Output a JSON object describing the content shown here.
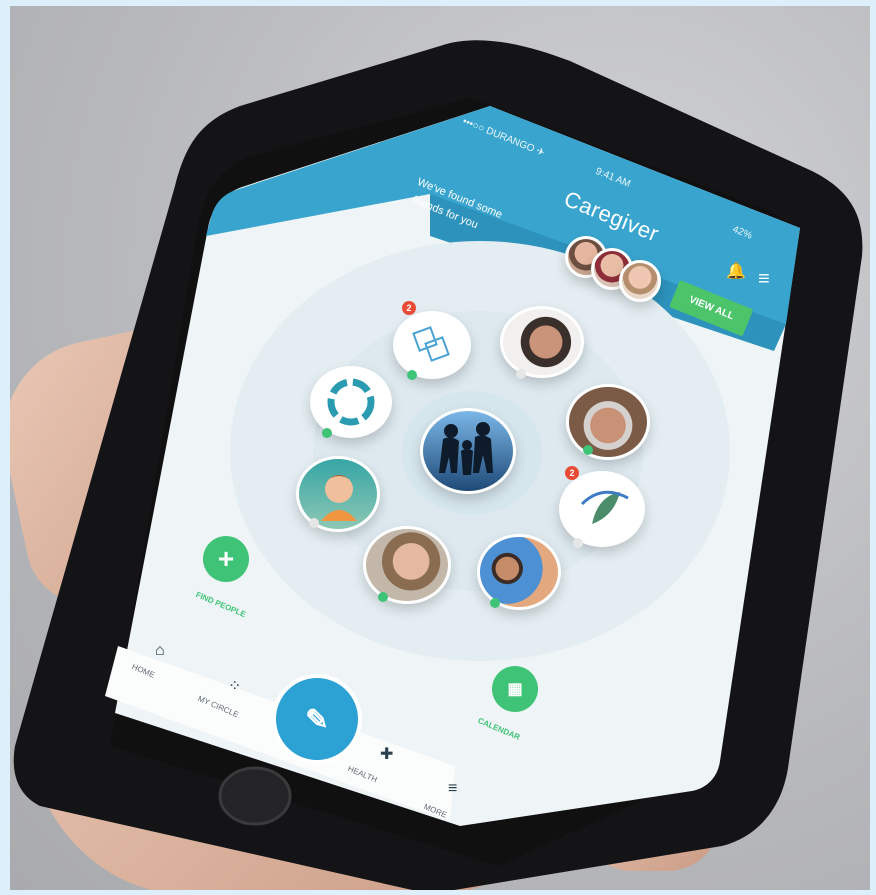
{
  "status_bar": {
    "carrier": "•••○○ DURANGO ✈",
    "time": "9:41 AM",
    "battery": "42%"
  },
  "header": {
    "title": "Caregiver",
    "found_text_1": "We've found some",
    "found_text_2": "friends for you",
    "view_all_label": "VIEW ALL"
  },
  "actions": {
    "find_people_label": "FIND PEOPLE",
    "calendar_label": "CALENDAR"
  },
  "badges": {
    "hub_badge": "2",
    "feather_badge": "2"
  },
  "nav": {
    "home_label": "HOME",
    "my_circle_label": "MY CIRCLE",
    "health_label": "HEALTH",
    "more_label": "MORE"
  },
  "colors": {
    "accent_blue": "#3aa6cf",
    "accent_green": "#4cc46a",
    "badge_red": "#e94b35"
  }
}
